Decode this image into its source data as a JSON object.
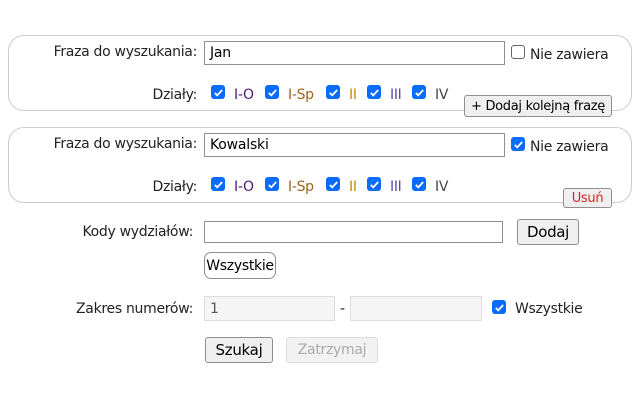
{
  "phrases": [
    {
      "label": "Fraza do wyszukania:",
      "value": "Jan",
      "not_contains_label": "Nie zawiera",
      "not_contains": false,
      "depts_label": "Działy:",
      "depts": [
        {
          "name": "I-O",
          "checked": true
        },
        {
          "name": "I-Sp",
          "checked": true
        },
        {
          "name": "II",
          "checked": true
        },
        {
          "name": "III",
          "checked": true
        },
        {
          "name": "IV",
          "checked": true
        }
      ],
      "action": "+ Dodaj kolejną frazę"
    },
    {
      "label": "Fraza do wyszukania:",
      "value": "Kowalski",
      "not_contains_label": "Nie zawiera",
      "not_contains": true,
      "depts_label": "Działy:",
      "depts": [
        {
          "name": "I-O",
          "checked": true
        },
        {
          "name": "I-Sp",
          "checked": true
        },
        {
          "name": "II",
          "checked": true
        },
        {
          "name": "III",
          "checked": true
        },
        {
          "name": "IV",
          "checked": true
        }
      ],
      "action": "Usuń"
    }
  ],
  "dept_colors": [
    "#4b1a7a",
    "#a0621a",
    "#c88a00",
    "#5a4aa8",
    "#444444"
  ],
  "codes": {
    "label": "Kody wydziałów:",
    "value": "",
    "add": "Dodaj",
    "all": "Wszystkie"
  },
  "range": {
    "label": "Zakres numerów:",
    "from": "1",
    "sep": "-",
    "to": "",
    "all_label": "Wszystkie",
    "all_checked": true
  },
  "buttons": {
    "search": "Szukaj",
    "stop": "Zatrzymaj"
  },
  "colors": {
    "accent": "#0a6cff",
    "danger": "#e02020"
  }
}
